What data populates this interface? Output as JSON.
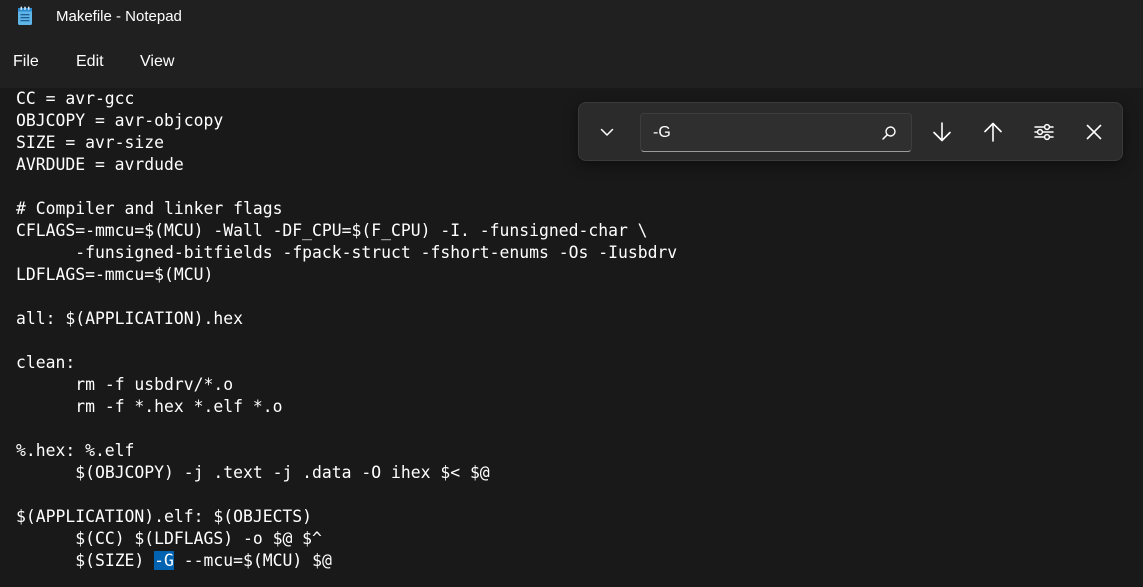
{
  "window": {
    "title": "Makefile - Notepad"
  },
  "menu": {
    "items": [
      "File",
      "Edit",
      "View"
    ]
  },
  "editor": {
    "lines": [
      "CC = avr-gcc",
      "OBJCOPY = avr-objcopy",
      "SIZE = avr-size",
      "AVRDUDE = avrdude",
      "",
      "# Compiler and linker flags",
      "CFLAGS=-mmcu=$(MCU) -Wall -DF_CPU=$(F_CPU) -I. -funsigned-char \\",
      "\t-funsigned-bitfields -fpack-struct -fshort-enums -Os -Iusbdrv",
      "LDFLAGS=-mmcu=$(MCU)",
      "",
      "all: $(APPLICATION).hex",
      "",
      "clean:",
      "\trm -f usbdrv/*.o",
      "\trm -f *.hex *.elf *.o",
      "",
      "%.hex: %.elf",
      "\t$(OBJCOPY) -j .text -j .data -O ihex $< $@",
      "",
      "$(APPLICATION).elf: $(OBJECTS)",
      "\t$(CC) $(LDFLAGS) -o $@ $^",
      "\t$(SIZE) -G --mcu=$(MCU) $@"
    ],
    "highlight": {
      "line": 21,
      "text": "-G"
    }
  },
  "find": {
    "value": "-G",
    "placeholder": "Find"
  },
  "colors": {
    "background": "#191919",
    "chrome": "#202020",
    "panel": "#2b2b2b",
    "selection": "#0063b1",
    "text": "#ffffff"
  },
  "icons": {
    "app": "notepad-icon",
    "expand": "chevron-down-icon",
    "search": "search-icon",
    "next": "arrow-down-icon",
    "previous": "arrow-up-icon",
    "options": "sliders-icon",
    "close": "close-icon"
  }
}
